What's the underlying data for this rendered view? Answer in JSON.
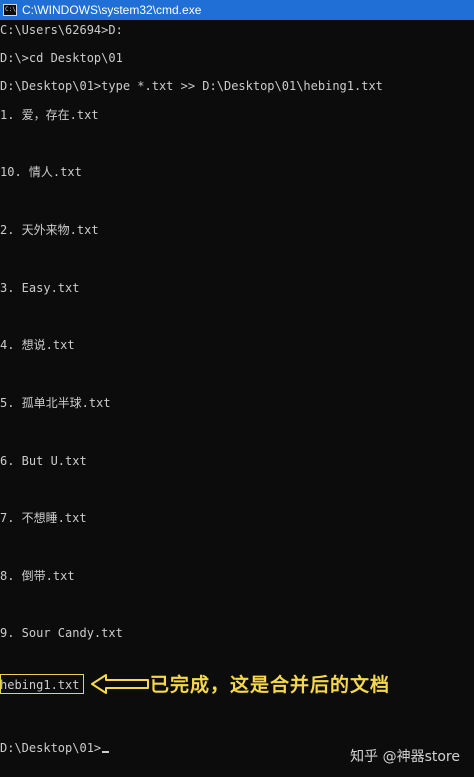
{
  "window": {
    "title": "C:\\WINDOWS\\system32\\cmd.exe",
    "icon": "cmd-console-icon"
  },
  "console": {
    "lines": [
      "C:\\Users\\62694>D:",
      "D:\\>cd Desktop\\01",
      "D:\\Desktop\\01>type *.txt >> D:\\Desktop\\01\\hebing1.txt",
      "1. 爱，存在.txt",
      "10. 情人.txt",
      "2. 天外来物.txt",
      "3. Easy.txt",
      "4. 想说.txt",
      "5. 孤单北半球.txt",
      "6. But U.txt",
      "7. 不想睡.txt",
      "8. 倒带.txt",
      "9. Sour Candy.txt",
      "hebing1.txt",
      "D:\\Desktop\\01>"
    ]
  },
  "annotation": {
    "text": "已完成，这是合并后的文档",
    "color": "#f6d84a"
  },
  "watermark": {
    "text": "知乎 @神器store"
  }
}
